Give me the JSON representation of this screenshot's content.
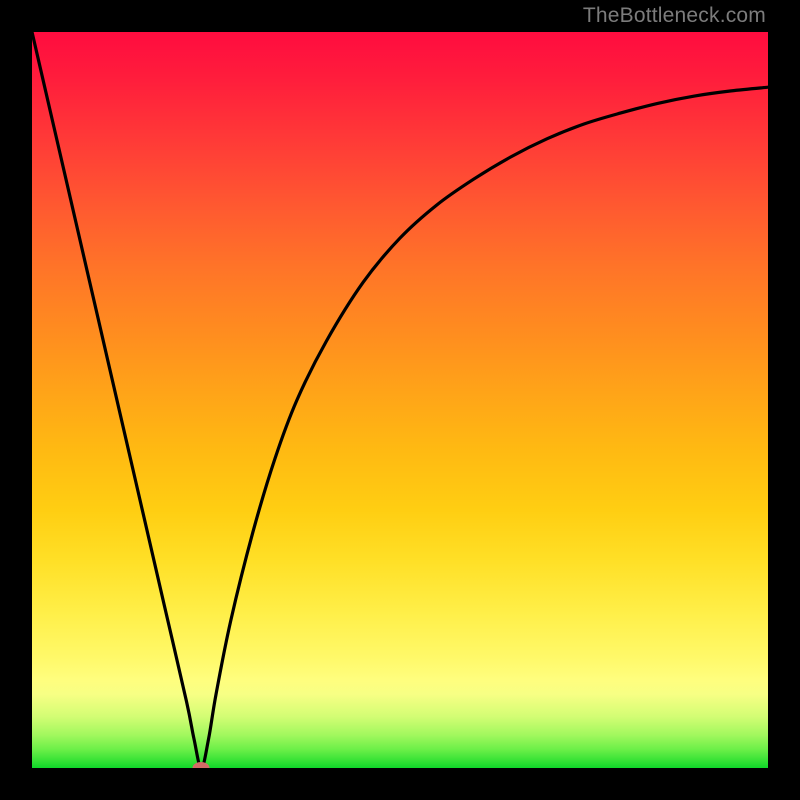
{
  "watermark": "TheBottleneck.com",
  "chart_data": {
    "type": "line",
    "title": "",
    "xlabel": "",
    "ylabel": "",
    "xlim": [
      0,
      100
    ],
    "ylim": [
      0,
      100
    ],
    "grid": false,
    "series": [
      {
        "name": "bottleneck-curve",
        "x": [
          0,
          3,
          6,
          9,
          12,
          15,
          18,
          21,
          22,
          23,
          24,
          25,
          27,
          30,
          33,
          36,
          40,
          45,
          50,
          55,
          60,
          65,
          70,
          75,
          80,
          85,
          90,
          95,
          100
        ],
        "y": [
          100,
          87,
          74,
          61,
          48,
          35,
          22,
          9,
          4,
          0,
          4,
          10,
          20,
          32,
          42,
          50,
          58,
          66,
          72,
          76.5,
          80,
          83,
          85.5,
          87.5,
          89,
          90.3,
          91.3,
          92,
          92.5
        ]
      }
    ],
    "marker": {
      "x": 23,
      "y": 0,
      "color": "#d36b66"
    },
    "gradient_stops": [
      {
        "pos": 0,
        "color": "#ff0c3f"
      },
      {
        "pos": 50,
        "color": "#ffa418"
      },
      {
        "pos": 88,
        "color": "#fffe7e"
      },
      {
        "pos": 100,
        "color": "#0fd729"
      }
    ]
  }
}
